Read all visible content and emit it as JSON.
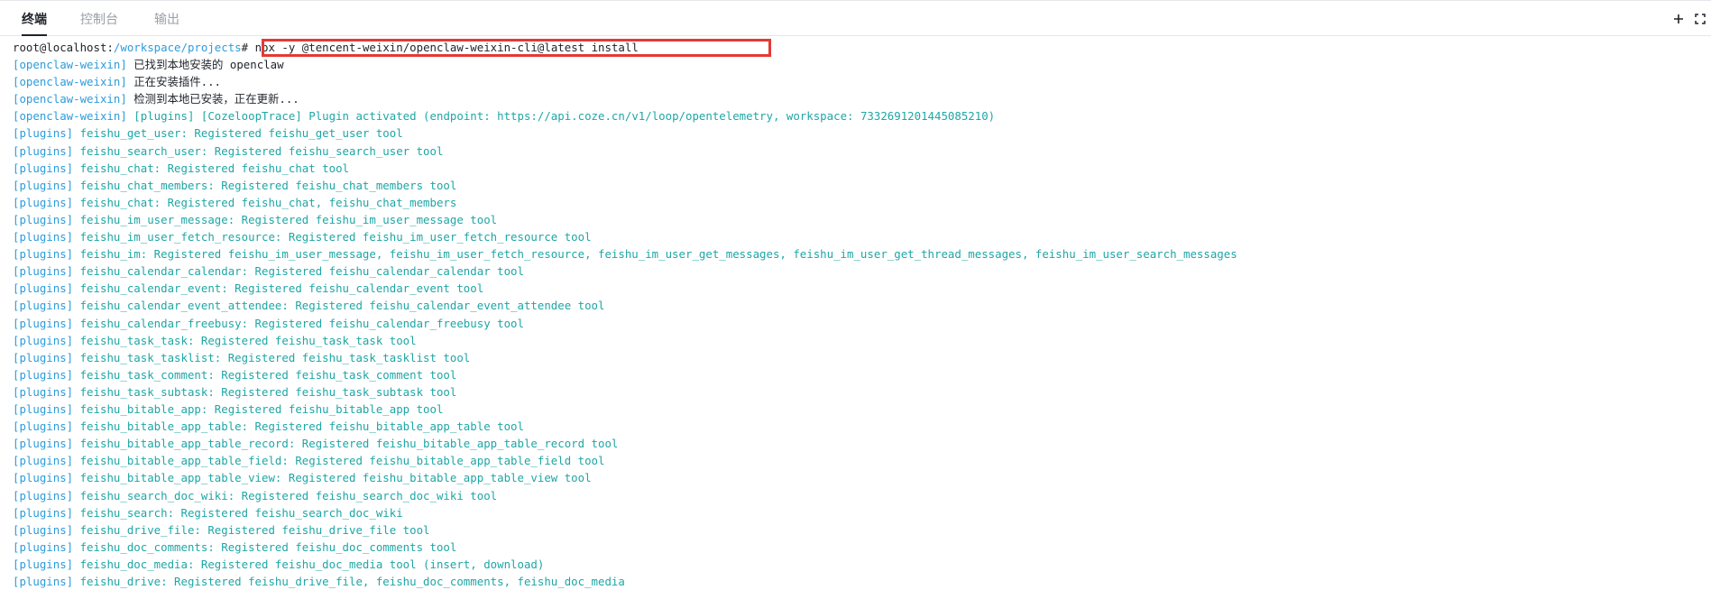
{
  "tabs": [
    {
      "label": "终端",
      "active": true
    },
    {
      "label": "控制台",
      "active": false
    },
    {
      "label": "输出",
      "active": false
    }
  ],
  "actions": {
    "add_icon": "plus-icon",
    "fullscreen_icon": "fullscreen-icon"
  },
  "colors": {
    "accent": "#2d9cdb",
    "info": "#1fa6a6",
    "text": "#1f2329",
    "highlight": "#e53935"
  },
  "terminal": {
    "prompt_user": "root@localhost",
    "prompt_sep": ":",
    "prompt_path": "/workspace/projects",
    "prompt_symbol": "#",
    "command": " npx -y @tencent-weixin/openclaw-weixin-cli@latest install",
    "lines": [
      {
        "tag": "[openclaw-weixin]",
        "text": " 已找到本地安装的 openclaw"
      },
      {
        "tag": "[openclaw-weixin]",
        "text": " 正在安装插件..."
      },
      {
        "tag": "[openclaw-weixin]",
        "text": " 检测到本地已安装，正在更新..."
      },
      {
        "tag": "[openclaw-weixin]",
        "text": " [plugins] [CozeloopTrace] Plugin activated (endpoint: https://api.coze.cn/v1/loop/opentelemetry, workspace: 7332691201445085210)"
      },
      {
        "tag": "[plugins]",
        "text": " feishu_get_user: Registered feishu_get_user tool"
      },
      {
        "tag": "[plugins]",
        "text": " feishu_search_user: Registered feishu_search_user tool"
      },
      {
        "tag": "[plugins]",
        "text": " feishu_chat: Registered feishu_chat tool"
      },
      {
        "tag": "[plugins]",
        "text": " feishu_chat_members: Registered feishu_chat_members tool"
      },
      {
        "tag": "[plugins]",
        "text": " feishu_chat: Registered feishu_chat, feishu_chat_members"
      },
      {
        "tag": "[plugins]",
        "text": " feishu_im_user_message: Registered feishu_im_user_message tool"
      },
      {
        "tag": "[plugins]",
        "text": " feishu_im_user_fetch_resource: Registered feishu_im_user_fetch_resource tool"
      },
      {
        "tag": "[plugins]",
        "text": " feishu_im: Registered feishu_im_user_message, feishu_im_user_fetch_resource, feishu_im_user_get_messages, feishu_im_user_get_thread_messages, feishu_im_user_search_messages"
      },
      {
        "tag": "[plugins]",
        "text": " feishu_calendar_calendar: Registered feishu_calendar_calendar tool"
      },
      {
        "tag": "[plugins]",
        "text": " feishu_calendar_event: Registered feishu_calendar_event tool"
      },
      {
        "tag": "[plugins]",
        "text": " feishu_calendar_event_attendee: Registered feishu_calendar_event_attendee tool"
      },
      {
        "tag": "[plugins]",
        "text": " feishu_calendar_freebusy: Registered feishu_calendar_freebusy tool"
      },
      {
        "tag": "[plugins]",
        "text": " feishu_task_task: Registered feishu_task_task tool"
      },
      {
        "tag": "[plugins]",
        "text": " feishu_task_tasklist: Registered feishu_task_tasklist tool"
      },
      {
        "tag": "[plugins]",
        "text": " feishu_task_comment: Registered feishu_task_comment tool"
      },
      {
        "tag": "[plugins]",
        "text": " feishu_task_subtask: Registered feishu_task_subtask tool"
      },
      {
        "tag": "[plugins]",
        "text": " feishu_bitable_app: Registered feishu_bitable_app tool"
      },
      {
        "tag": "[plugins]",
        "text": " feishu_bitable_app_table: Registered feishu_bitable_app_table tool"
      },
      {
        "tag": "[plugins]",
        "text": " feishu_bitable_app_table_record: Registered feishu_bitable_app_table_record tool"
      },
      {
        "tag": "[plugins]",
        "text": " feishu_bitable_app_table_field: Registered feishu_bitable_app_table_field tool"
      },
      {
        "tag": "[plugins]",
        "text": " feishu_bitable_app_table_view: Registered feishu_bitable_app_table_view tool"
      },
      {
        "tag": "[plugins]",
        "text": " feishu_search_doc_wiki: Registered feishu_search_doc_wiki tool"
      },
      {
        "tag": "[plugins]",
        "text": " feishu_search: Registered feishu_search_doc_wiki"
      },
      {
        "tag": "[plugins]",
        "text": " feishu_drive_file: Registered feishu_drive_file tool"
      },
      {
        "tag": "[plugins]",
        "text": " feishu_doc_comments: Registered feishu_doc_comments tool"
      },
      {
        "tag": "[plugins]",
        "text": " feishu_doc_media: Registered feishu_doc_media tool (insert, download)"
      },
      {
        "tag": "[plugins]",
        "text": " feishu_drive: Registered feishu_drive_file, feishu_doc_comments, feishu_doc_media"
      }
    ]
  }
}
